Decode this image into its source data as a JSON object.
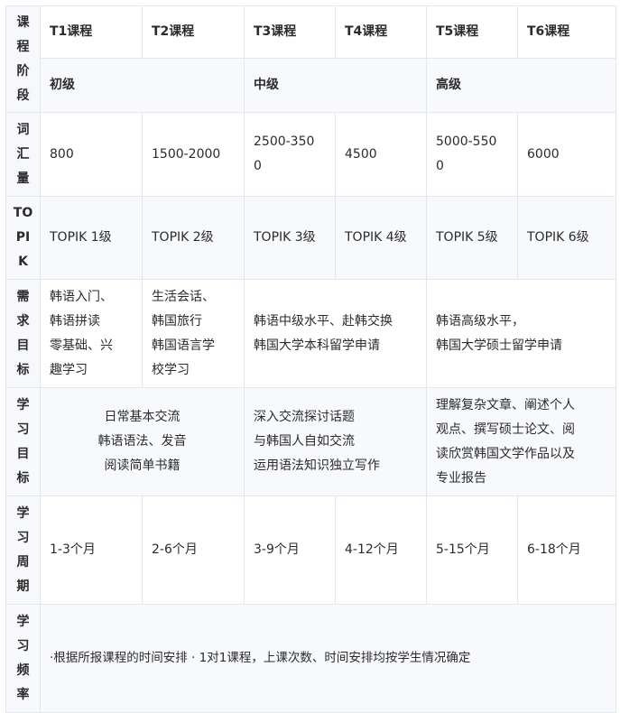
{
  "table": {
    "header": {
      "label": "课\n程\n阶\n段",
      "courses": [
        "T1课程",
        "T2课程",
        "T3课程",
        "T4课程",
        "T5课程",
        "T6课程"
      ]
    },
    "levels": [
      "初级",
      "中级",
      "高级"
    ],
    "vocab": {
      "label": "词\n汇\n量",
      "values": [
        "800",
        "1500-2000",
        "2500-350\n0",
        "4500",
        "5000-550\n0",
        "6000"
      ]
    },
    "topik": {
      "label": "TO\nPI\nK",
      "values": [
        "TOPIK 1级",
        "TOPIK 2级",
        "TOPIK 3级",
        "TOPIK 4级",
        "TOPIK 5级",
        "TOPIK 6级"
      ]
    },
    "needs": {
      "label": "需\n求\n目\n标",
      "t1": "韩语入门、\n韩语拼读\n零基础、兴\n趣学习",
      "t2": "生活会话、\n韩国旅行\n韩国语言学\n校学习",
      "mid": "韩语中级水平、赴韩交换\n韩国大学本科留学申请",
      "high": "韩语高级水平，\n韩国大学硕士留学申请"
    },
    "goals": {
      "label": "学\n习\n目\n标",
      "beginner": "日常基本交流\n韩语语法、发音\n阅读简单书籍",
      "mid": "深入交流探讨话题\n与韩国人自如交流\n运用语法知识独立写作",
      "high": "理解复杂文章、阐述个人\n观点、撰写硕士论文、阅\n读欣赏韩国文学作品以及\n专业报告"
    },
    "period": {
      "label": "学\n习\n周\n期",
      "values": [
        "1-3个月",
        "2-6个月",
        "3-9个月",
        "4-12个月",
        "5-15个月",
        "6-18个月"
      ]
    },
    "frequency": {
      "label": "学\n习\n频\n率",
      "text": "·根据所报课程的时间安排  · 1对1课程，上课次数、时间安排均按学生情况确定"
    }
  }
}
